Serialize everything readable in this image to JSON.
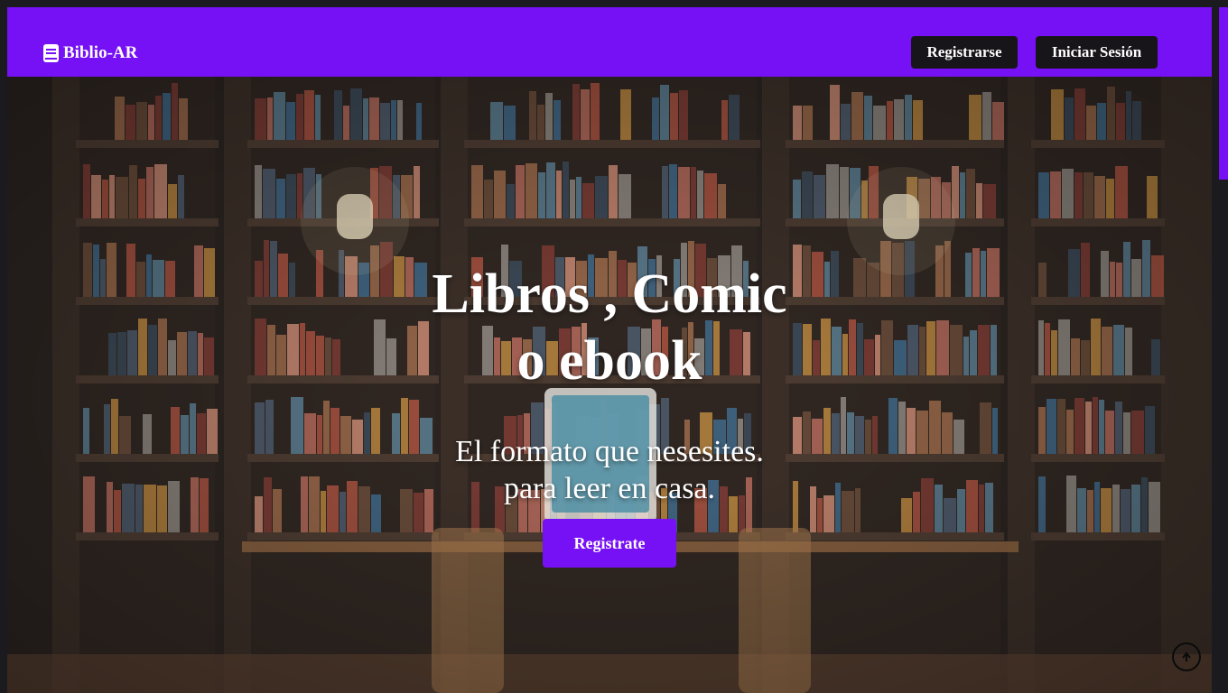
{
  "brand": {
    "name": "Biblio-AR",
    "icon": "book-icon"
  },
  "nav": {
    "register_label": "Registrarse",
    "login_label": "Iniciar Sesión"
  },
  "hero": {
    "title_line1": "Libros , Comic",
    "title_line2": "o ebook",
    "subtitle_line1": "El formato que nesesites.",
    "subtitle_line2": "para leer en casa.",
    "cta_label": "Registrate",
    "background": "bookshelf-library-image"
  },
  "icons": {
    "scroll_top": "arrow-up-circle-icon"
  },
  "colors": {
    "accent": "#7610f5",
    "nav_button_bg": "#17151a",
    "text": "#ffffff"
  }
}
